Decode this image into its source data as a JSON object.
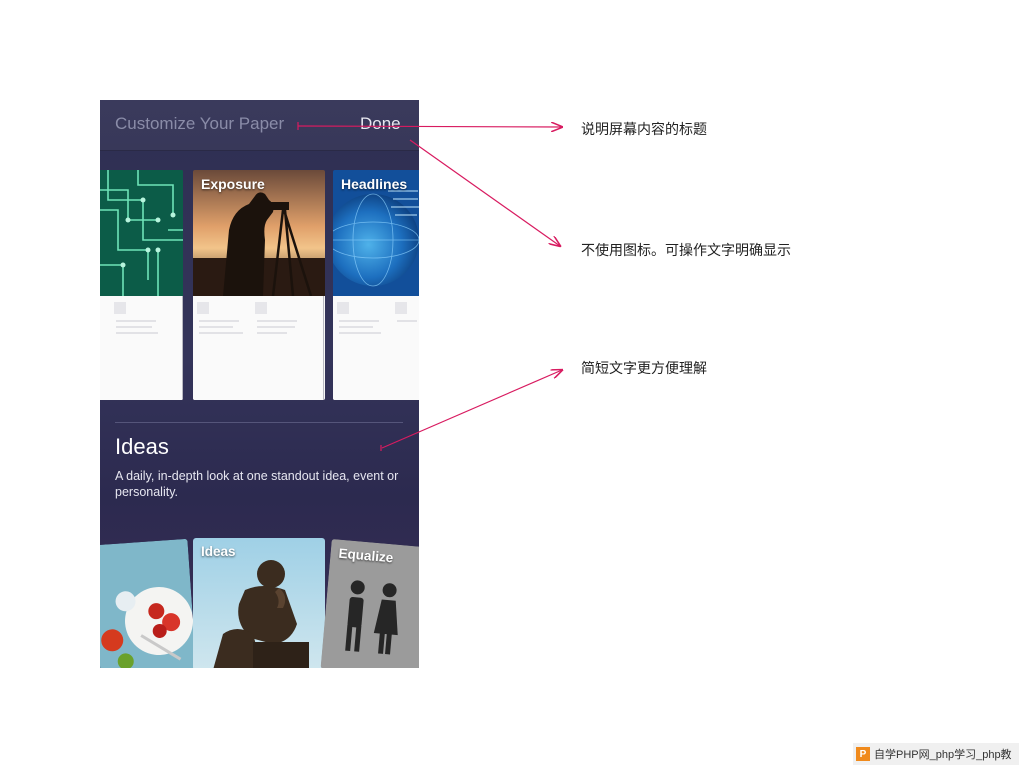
{
  "navbar": {
    "title": "Customize Your Paper",
    "done_label": "Done"
  },
  "cards_top": [
    {
      "label": ""
    },
    {
      "label": "Exposure"
    },
    {
      "label": "Headlines"
    }
  ],
  "section": {
    "title": "Ideas",
    "description": "A daily, in-depth look at one standout idea, event or personality."
  },
  "cards_bottom": [
    {
      "label": ""
    },
    {
      "label": "Ideas"
    },
    {
      "label": "Equalize"
    }
  ],
  "annotations": [
    {
      "text": "说明屏幕内容的标题"
    },
    {
      "text": "不使用图标。可操作文字明确显示"
    },
    {
      "text": "简短文字更方便理解"
    }
  ],
  "watermark": {
    "logo": "P",
    "text": "自学PHP网_php学习_php教"
  },
  "colors": {
    "annotation_arrow": "#d81b60",
    "background_top": "#2e2f52",
    "background_bottom": "#3a2e57"
  }
}
